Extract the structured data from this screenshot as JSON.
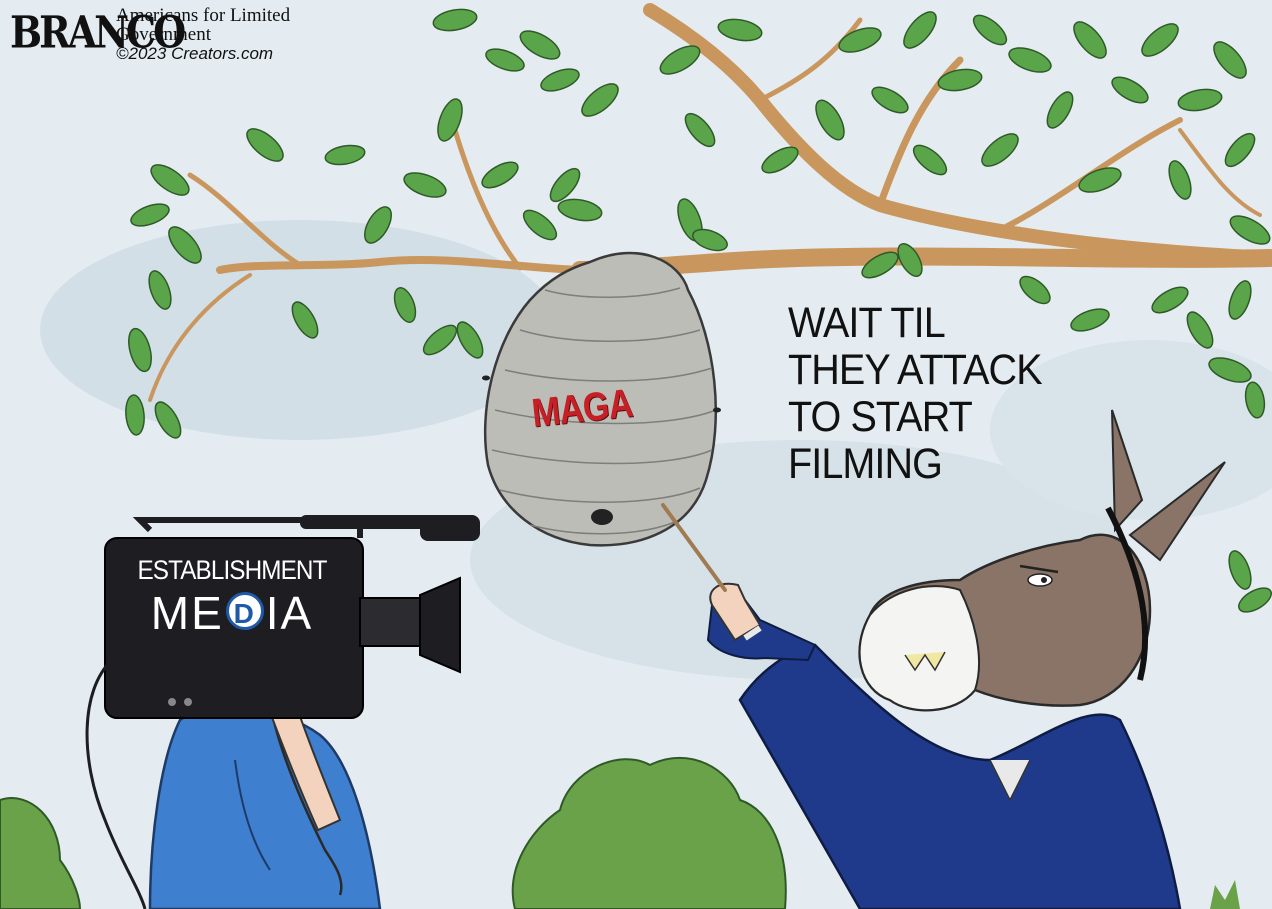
{
  "cartoon": {
    "signature": "BRANCO",
    "credit_line1": "Americans for Limited",
    "credit_line2": "Government",
    "credit_line3": "©2023 Creators.com",
    "speech_lines": [
      "WAIT TIL",
      "THEY ATTACK",
      "TO START",
      "FILMING"
    ],
    "hive_label": "MAGA",
    "camera_line1": "ESTABLISHMENT",
    "camera_line2_left": "ME",
    "camera_logo_letter": "D",
    "camera_line2_right": "IA"
  },
  "colors": {
    "sky": "#dfe8ee",
    "leaf": "#5aa54a",
    "branch": "#c9975d",
    "hive": "#b9b9b5",
    "maga_red": "#c62026",
    "camera_body": "#1d1d22",
    "suit_blue": "#1f3a8a",
    "robe_blue": "#3f7fcf",
    "donkey_brown": "#8a7468",
    "bush_green": "#6aa24a"
  },
  "icons": [
    "donkey-character",
    "video-camera",
    "wasp-nest",
    "tree-branch",
    "democratic-d-logo"
  ]
}
